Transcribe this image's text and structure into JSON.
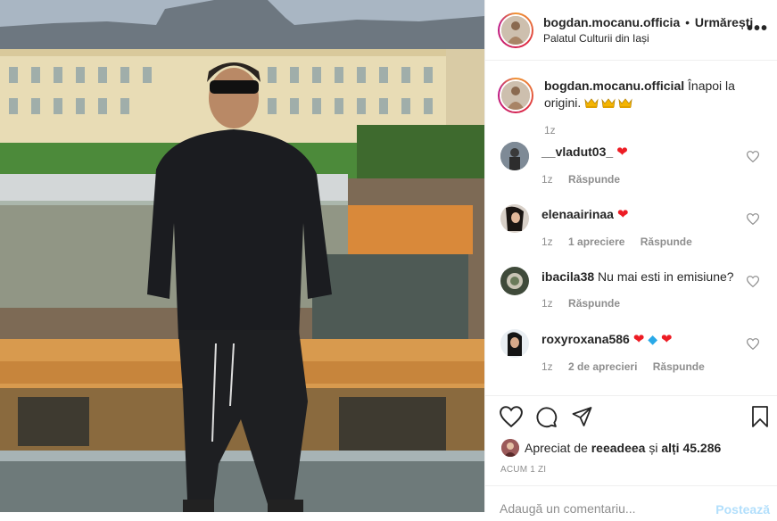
{
  "colors": {
    "accent": "#0095f6",
    "post_disabled": "#b2dffc",
    "heart": "#ed1c24",
    "muted": "#8e8e8e",
    "text": "#262626"
  },
  "photo": {
    "description_icon": "post-photo"
  },
  "header": {
    "username": "bogdan.mocanu.officia",
    "separator": "•",
    "follow_label": "Urmărești",
    "location": "Palatul Culturii din Iași",
    "more_icon": "more-horizontal-icon"
  },
  "caption": {
    "username": "bogdan.mocanu.official",
    "text": "Înapoi la origini.",
    "emojis": [
      "crown",
      "crown",
      "crown"
    ],
    "time": "1z"
  },
  "comments": [
    {
      "username": "__vladut03_",
      "text": "",
      "emojis": [
        "red-heart"
      ],
      "time": "1z",
      "likes": "",
      "reply": "Răspunde"
    },
    {
      "username": "elenaairinaa",
      "text": "",
      "emojis": [
        "red-heart"
      ],
      "time": "1z",
      "likes": "1 apreciere",
      "reply": "Răspunde"
    },
    {
      "username": "ibacila38",
      "text": "Nu mai esti in emisiune?",
      "emojis": [],
      "time": "1z",
      "likes": "",
      "reply": "Răspunde"
    },
    {
      "username": "roxyroxana586",
      "text": "",
      "emojis": [
        "red-heart",
        "blue-diamond",
        "red-heart"
      ],
      "time": "1z",
      "likes": "2 de aprecieri",
      "reply": "Răspunde"
    }
  ],
  "actions": {
    "liked_prefix": "Apreciat de",
    "liked_user": "reeadeea",
    "liked_mid": "și",
    "liked_others": "alți 45.286",
    "time_ago": "ACUM 1 ZI"
  },
  "add_comment": {
    "placeholder": "Adaugă un comentariu...",
    "post_label": "Postează"
  }
}
